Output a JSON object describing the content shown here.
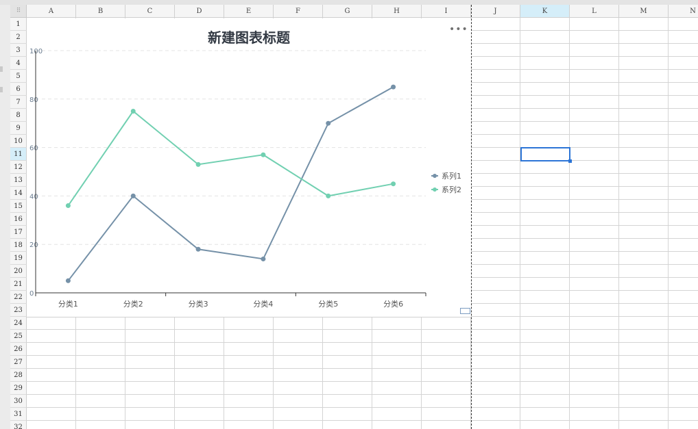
{
  "spreadsheet": {
    "columns": [
      "A",
      "B",
      "C",
      "D",
      "E",
      "F",
      "G",
      "H",
      "I",
      "J",
      "K",
      "L",
      "M",
      "N"
    ],
    "rows": [
      "1",
      "2",
      "3",
      "4",
      "5",
      "6",
      "7",
      "8",
      "9",
      "10",
      "11",
      "12",
      "13",
      "14",
      "15",
      "16",
      "17",
      "18",
      "19",
      "20",
      "21",
      "22",
      "23",
      "24",
      "25",
      "26",
      "27",
      "28",
      "29",
      "30",
      "31",
      "32"
    ],
    "selected_column": "K",
    "selected_row": "11"
  },
  "chart": {
    "title": "新建图表标题",
    "more_icon": "more-dots-icon",
    "more_glyph": "•••"
  },
  "colors": {
    "series1": "#7591a8",
    "series2": "#71d0b1",
    "selection": "#2b74d6",
    "header_selected": "#d5eef9"
  },
  "chart_data": {
    "type": "line",
    "title": "新建图表标题",
    "categories": [
      "分类1",
      "分类2",
      "分类3",
      "分类4",
      "分类5",
      "分类6"
    ],
    "series": [
      {
        "name": "系列1",
        "values": [
          5,
          40,
          18,
          14,
          70,
          85
        ]
      },
      {
        "name": "系列2",
        "values": [
          36,
          75,
          53,
          57,
          40,
          45
        ]
      }
    ],
    "ylim": [
      0,
      100
    ],
    "yticks": [
      "0",
      "20",
      "40",
      "60",
      "80",
      "100"
    ],
    "grid": true,
    "legend": "right"
  }
}
